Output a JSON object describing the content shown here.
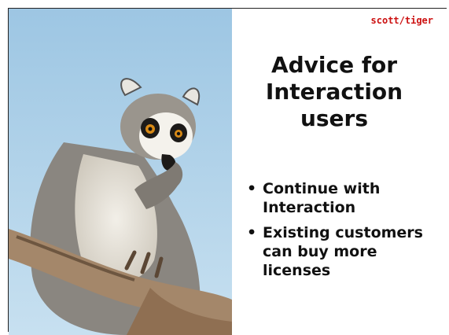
{
  "slide": {
    "brand": "scott/tiger",
    "title": "Advice for Interaction users",
    "bullets": [
      "Continue with Interaction",
      "Existing customers can buy more licenses"
    ],
    "bullet_glyph": "•"
  },
  "image": {
    "subject-icon": "ring-tailed-lemur-photo"
  },
  "colors": {
    "brand": "#cc1111",
    "sky": "#a9cde6",
    "text": "#111111"
  }
}
